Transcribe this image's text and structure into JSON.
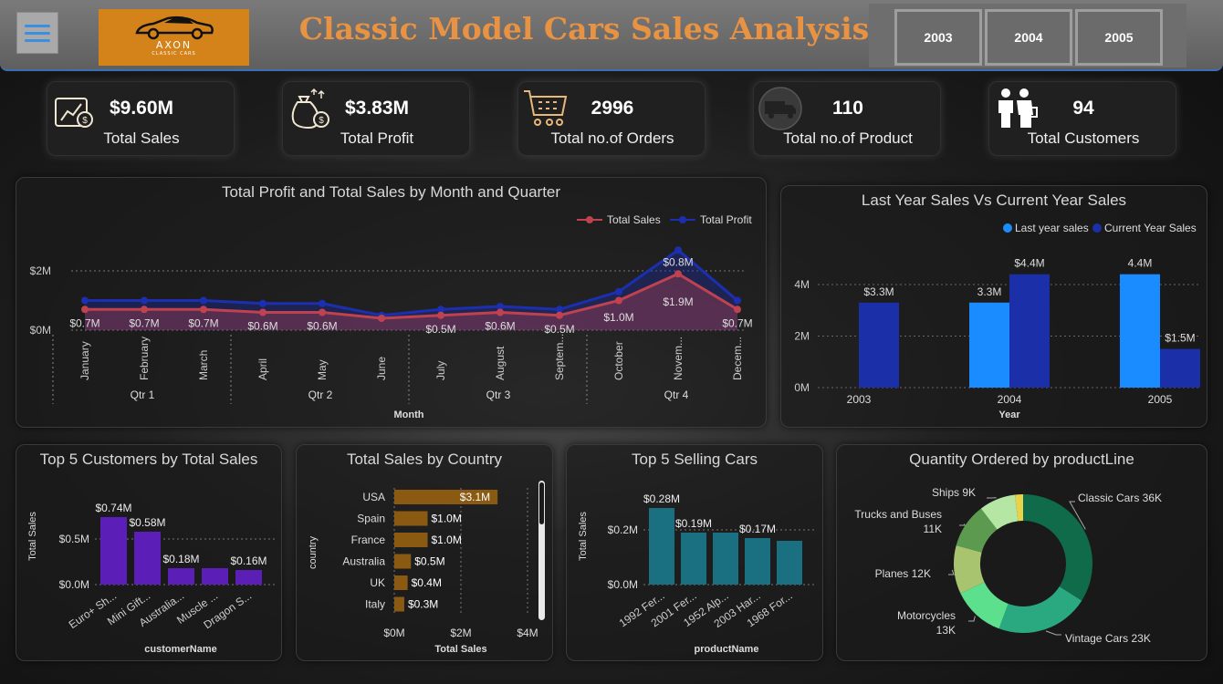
{
  "header": {
    "title": "Classic  Model Cars Sales Analysis",
    "logo_text": "AXON",
    "logo_sub": "CLASSIC CARS",
    "years": [
      "2003",
      "2004",
      "2005"
    ]
  },
  "kpis": [
    {
      "value": "$9.60M",
      "label": "Total Sales",
      "icon": "money-bag-icon"
    },
    {
      "value": "$3.83M",
      "label": "Total Profit",
      "icon": "profit-bag-icon"
    },
    {
      "value": "2996",
      "label": "Total no.of Orders",
      "icon": "cart-icon"
    },
    {
      "value": "110",
      "label": "Total no.of Product",
      "icon": "truck-icon"
    },
    {
      "value": "94",
      "label": "Total Customers",
      "icon": "customers-icon"
    }
  ],
  "colors": {
    "sales_line": "#c0424f",
    "profit_line": "#1c2fb0",
    "last_year": "#1a8cff",
    "current_year": "#1a2fa8",
    "customers_bar": "#5b1fb8",
    "country_bar": "#8a5a12",
    "cars_bar": "#1a6f80",
    "title_orange": "#e89243"
  },
  "chart_data": [
    {
      "type": "line",
      "title": "Total Profit and Total Sales by Month and Quarter",
      "xlabel": "Month",
      "categories": [
        "January",
        "February",
        "March",
        "April",
        "May",
        "June",
        "July",
        "August",
        "Septem...",
        "October",
        "Novem...",
        "Decem..."
      ],
      "quarters": [
        "Qtr 1",
        "Qtr 2",
        "Qtr 3",
        "Qtr 4"
      ],
      "yticks": [
        "$0M",
        "$2M"
      ],
      "ylim": [
        0,
        2.6
      ],
      "series": [
        {
          "name": "Total Sales",
          "values": [
            0.7,
            0.7,
            0.7,
            0.6,
            0.6,
            0.4,
            0.5,
            0.6,
            0.5,
            1.0,
            1.9,
            0.7
          ],
          "labels": [
            "$0.7M",
            "$0.7M",
            "$0.7M",
            "$0.6M",
            "$0.6M",
            "",
            "$0.5M",
            "$0.6M",
            "$0.5M",
            "$1.0M",
            "$1.9M",
            "$0.7M"
          ]
        },
        {
          "name": "Total Profit",
          "values": [
            1.0,
            1.0,
            1.0,
            0.9,
            0.9,
            0.5,
            0.7,
            0.8,
            0.7,
            1.3,
            2.7,
            1.0
          ],
          "labels": [
            "",
            "",
            "",
            "",
            "",
            "",
            "",
            "",
            "",
            "",
            "$0.8M",
            ""
          ]
        }
      ],
      "legend": "top-right",
      "grid": true
    },
    {
      "type": "bar",
      "title": "Last Year Sales Vs Current Year Sales",
      "xlabel": "Year",
      "categories": [
        "2003",
        "2004",
        "2005"
      ],
      "yticks": [
        "0M",
        "2M",
        "4M"
      ],
      "ylim": [
        0,
        4.9
      ],
      "series": [
        {
          "name": "Last year sales",
          "values": [
            null,
            3.3,
            4.4
          ],
          "labels": [
            "",
            "3.3M",
            "4.4M"
          ]
        },
        {
          "name": "Current Year Sales",
          "values": [
            3.3,
            4.4,
            1.5
          ],
          "labels": [
            "$3.3M",
            "$4.4M",
            "$1.5M"
          ]
        }
      ],
      "legend": "top-right"
    },
    {
      "type": "bar",
      "title": "Top 5 Customers by Total Sales",
      "xlabel": "customerName",
      "ylabel": "Total Sales",
      "categories": [
        "Euro+ Sh...",
        "Mini Gift...",
        "Australia...",
        "Muscle ...",
        "Dragon S..."
      ],
      "values": [
        0.74,
        0.58,
        0.18,
        0.18,
        0.16
      ],
      "labels": [
        "$0.74M",
        "$0.58M",
        "$0.18M",
        "",
        "$0.16M"
      ],
      "yticks": [
        "$0.0M",
        "$0.5M"
      ],
      "ylim": [
        0,
        0.8
      ]
    },
    {
      "type": "bar",
      "orientation": "horizontal",
      "title": "Total Sales by Country",
      "xlabel": "Total Sales",
      "ylabel": "country",
      "categories": [
        "USA",
        "Spain",
        "France",
        "Australia",
        "UK",
        "Italy"
      ],
      "values": [
        3.1,
        1.0,
        1.0,
        0.5,
        0.4,
        0.3
      ],
      "labels": [
        "$3.1M",
        "$1.0M",
        "$1.0M",
        "$0.5M",
        "$0.4M",
        "$0.3M"
      ],
      "xticks": [
        "$0M",
        "$2M",
        "$4M"
      ],
      "xlim": [
        0,
        4
      ]
    },
    {
      "type": "bar",
      "title": "Top 5 Selling Cars",
      "xlabel": "productName",
      "ylabel": "Total Sales",
      "categories": [
        "1992 Fer...",
        "2001 Fer...",
        "1952 Alp...",
        "2003 Har...",
        "1968 For..."
      ],
      "values": [
        0.28,
        0.19,
        0.19,
        0.17,
        0.16
      ],
      "labels": [
        "$0.28M",
        "$0.19M",
        "",
        "$0.17M",
        ""
      ],
      "yticks": [
        "$0.0M",
        "$0.2M"
      ],
      "ylim": [
        0,
        0.3
      ]
    },
    {
      "type": "pie",
      "donut": true,
      "title": "Quantity Ordered by productLine",
      "slices": [
        {
          "label": "Classic Cars 36K",
          "value": 36,
          "color": "#0f6b4a"
        },
        {
          "label": "Vintage Cars 23K",
          "value": 23,
          "color": "#2aa880"
        },
        {
          "label": "Motorcycles 13K",
          "value": 13,
          "color": "#5ce08e"
        },
        {
          "label": "Planes 12K",
          "value": 12,
          "color": "#a9c46e"
        },
        {
          "label": "Trucks and Buses 11K",
          "value": 11,
          "color": "#5c9a4f"
        },
        {
          "label": "Ships 9K",
          "value": 9,
          "color": "#b5e6a4"
        },
        {
          "label": "",
          "value": 2,
          "color": "#e8d24a"
        }
      ]
    }
  ]
}
